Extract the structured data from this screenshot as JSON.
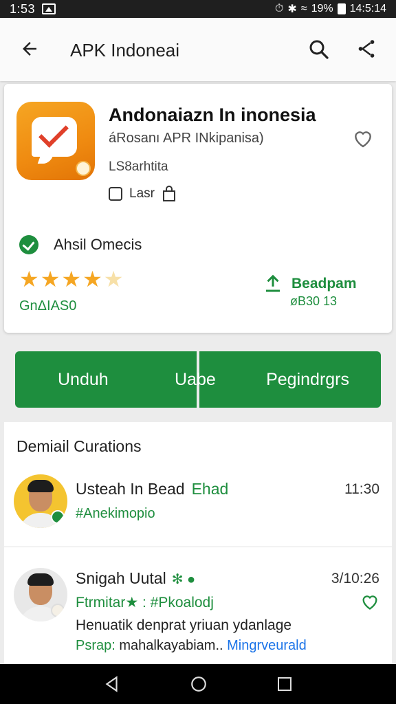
{
  "status_bar": {
    "time": "1:53",
    "battery": "19%",
    "clock_right": "14:5:14"
  },
  "app_bar": {
    "title": "APK Indoneai"
  },
  "app": {
    "name": "Andonaiazn In inonesia",
    "subtitle": "áRosanı APR INkipanisa)",
    "developer": "LS8arhtita",
    "meta_label": "Lasr",
    "verified_label": "Ahsil Omecis",
    "rating_value": 4.5,
    "rating_count": "GnΔIAS0",
    "download_label": "Beadpam",
    "download_size": "øB30 13"
  },
  "actions": {
    "install": "Unduh",
    "update": "Uabe",
    "manage": "Pegindrgrs"
  },
  "reviews": {
    "title": "Demiail Curations",
    "items": [
      {
        "name": "Usteah In Bead",
        "edit": "Ehad",
        "time": "11:30",
        "tag": "#Anekimopio"
      },
      {
        "name": "Snigah Uutal",
        "time": "3/10:26",
        "tags": "Ftrmitar★ : #Pkoalodj",
        "body": "Henuatik denprat yriuan ydanlage",
        "label": "Psrap:",
        "body2": "mahalkayabiam..",
        "link": "Mingrveurald"
      }
    ]
  },
  "colors": {
    "accent": "#1e8e3e",
    "star": "#f5a623",
    "app_icon": "#ef8a10",
    "link": "#1a73e8"
  }
}
